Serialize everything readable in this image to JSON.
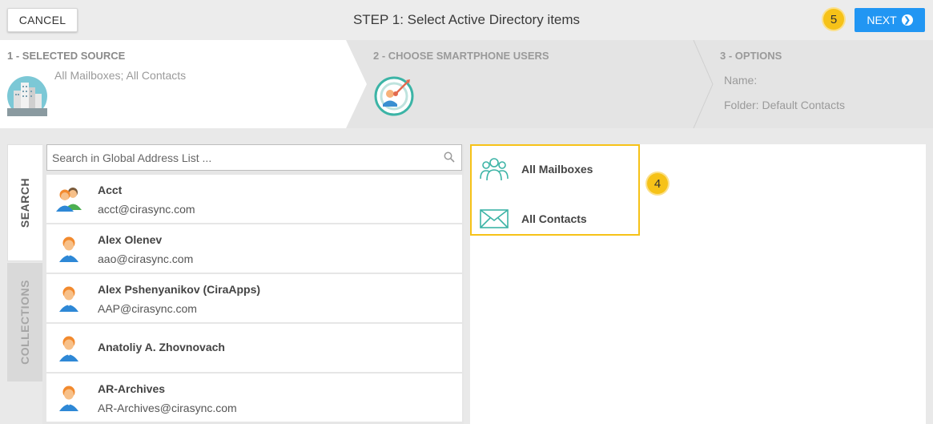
{
  "header": {
    "cancel_label": "CANCEL",
    "title": "STEP 1: Select Active Directory items",
    "next_label": "NEXT",
    "next_badge": "5"
  },
  "steps": [
    {
      "title": "1 - SELECTED SOURCE",
      "text": "All Mailboxes; All Contacts",
      "icon": "city-buildings-icon"
    },
    {
      "title": "2 - CHOOSE SMARTPHONE USERS",
      "icon": "target-user-icon"
    },
    {
      "title": "3 - OPTIONS",
      "name_label": "Name:",
      "folder_label": "Folder: Default Contacts"
    }
  ],
  "tabs": {
    "search_label": "SEARCH",
    "collections_label": "COLLECTIONS"
  },
  "search": {
    "placeholder": "Search in Global Address List ...",
    "value": ""
  },
  "users": [
    {
      "name": "Acct",
      "email": "acct@cirasync.com",
      "icon": "group-avatar-icon"
    },
    {
      "name": "Alex Olenev",
      "email": "aao@cirasync.com",
      "icon": "user-avatar-icon"
    },
    {
      "name": "Alex Pshenyanikov (CiraApps)",
      "email": "AAP@cirasync.com",
      "icon": "user-avatar-icon"
    },
    {
      "name": "Anatoliy A. Zhovnovach",
      "email": "",
      "icon": "user-avatar-icon"
    },
    {
      "name": "AR-Archives",
      "email": "AR-Archives@cirasync.com",
      "icon": "user-avatar-icon"
    }
  ],
  "selected": {
    "badge": "4",
    "items": [
      {
        "label": "All Mailboxes",
        "icon": "people-group-icon"
      },
      {
        "label": "All Contacts",
        "icon": "envelope-icon"
      }
    ]
  },
  "colors": {
    "accent": "#2196f3",
    "highlight": "#f6c218",
    "teal": "#3cb4a6"
  }
}
